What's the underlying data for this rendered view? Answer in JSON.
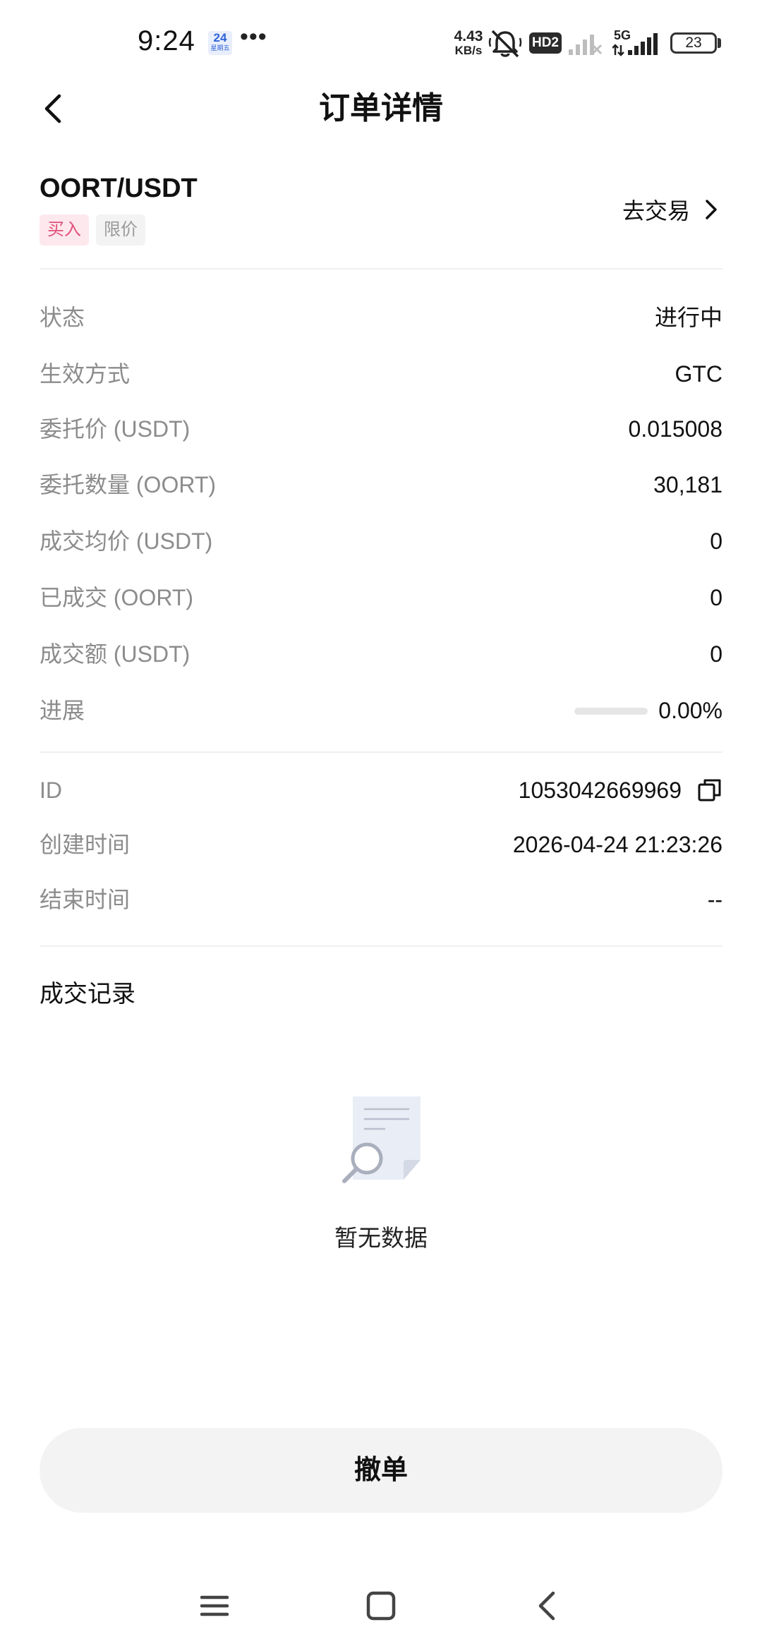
{
  "status_bar": {
    "time": "9:24",
    "calendar_day": "24",
    "calendar_sub": "星期五",
    "more_dots": "•••",
    "net_speed_value": "4.43",
    "net_speed_unit": "KB/s",
    "hd_label": "HD2",
    "network_label": "5G",
    "battery": "23"
  },
  "header": {
    "title": "订单详情"
  },
  "pair": {
    "name": "OORT/USDT",
    "side_tag": "买入",
    "type_tag": "限价",
    "go_trade": "去交易"
  },
  "details": [
    {
      "label": "状态",
      "value": "进行中"
    },
    {
      "label": "生效方式",
      "value": "GTC"
    },
    {
      "label": "委托价 (USDT)",
      "value": "0.015008"
    },
    {
      "label": "委托数量 (OORT)",
      "value": "30,181"
    },
    {
      "label": "成交均价 (USDT)",
      "value": "0"
    },
    {
      "label": "已成交 (OORT)",
      "value": "0"
    },
    {
      "label": "成交额 (USDT)",
      "value": "0"
    },
    {
      "label": "进展",
      "value": "0.00%"
    }
  ],
  "progress_fraction": 0,
  "meta": [
    {
      "label": "ID",
      "value": "1053042669969"
    },
    {
      "label": "创建时间",
      "value": "2026-04-24 21:23:26"
    },
    {
      "label": "结束时间",
      "value": "--"
    }
  ],
  "records": {
    "title": "成交记录",
    "empty_text": "暂无数据"
  },
  "cancel_button": "撤单",
  "icons": {
    "back": "chevron-left-icon",
    "go_trade": "chevron-right-icon",
    "copy": "copy-icon",
    "empty": "document-search-icon",
    "nav_menu": "menu-icon",
    "nav_home": "home-square-icon",
    "nav_back": "back-triangle-icon"
  },
  "colors": {
    "buy_tag_bg": "#fde8ee",
    "buy_tag_text": "#e0507a",
    "label_gray": "#8c8c8c",
    "divider": "#f0f0f0",
    "button_bg": "#f3f3f3"
  }
}
